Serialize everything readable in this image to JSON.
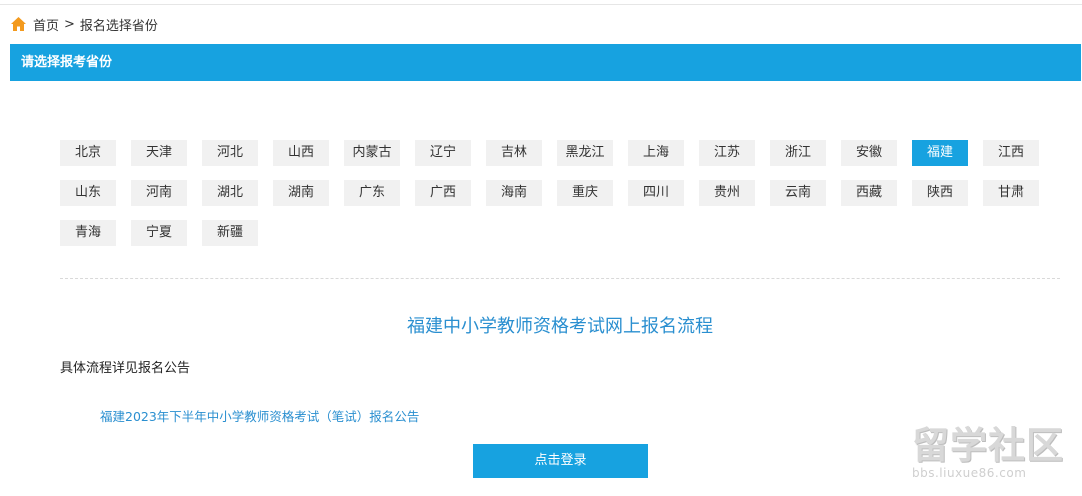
{
  "breadcrumb": {
    "home_icon": "home-icon",
    "home_label": "首页",
    "separator": ">",
    "current": "报名选择省份"
  },
  "header": {
    "title": "请选择报考省份"
  },
  "provinces": [
    [
      "北京",
      "天津",
      "河北",
      "山西",
      "内蒙古",
      "辽宁",
      "吉林",
      "黑龙江",
      "上海",
      "江苏",
      "浙江",
      "安徽",
      "福建",
      "江西"
    ],
    [
      "山东",
      "河南",
      "湖北",
      "湖南",
      "广东",
      "广西",
      "海南",
      "重庆",
      "四川",
      "贵州",
      "云南",
      "西藏",
      "陕西",
      "甘肃"
    ],
    [
      "青海",
      "宁夏",
      "新疆"
    ]
  ],
  "selected_province": "福建",
  "main": {
    "flow_title": "福建中小学教师资格考试网上报名流程",
    "detail_text": "具体流程详见报名公告",
    "notice_link": "福建2023年下半年中小学教师资格考试（笔试）报名公告",
    "login_button": "点击登录"
  },
  "watermark": {
    "logo_text": "留学社区",
    "url_text": "bbs.liuxue86.com"
  },
  "colors": {
    "accent": "#17a2e0",
    "link": "#2a8fd0",
    "tile_bg": "#f1f1f1",
    "home_icon": "#f39a1e"
  }
}
